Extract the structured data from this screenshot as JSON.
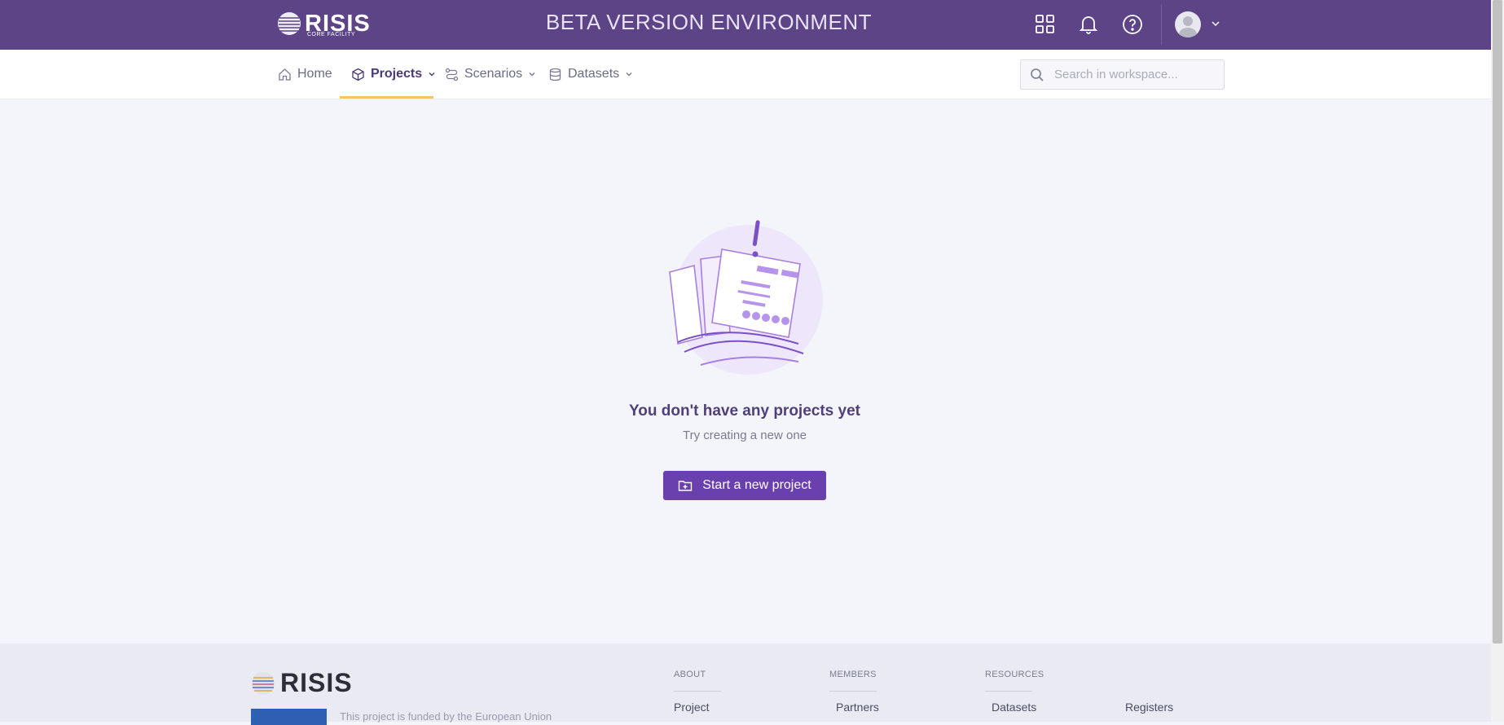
{
  "topbar": {
    "logo_name": "RISIS",
    "logo_sub": "CORE FACILITY",
    "env_title": "BETA VERSION ENVIRONMENT"
  },
  "nav": {
    "items": [
      {
        "label": "Home",
        "icon": "home-icon"
      },
      {
        "label": "Projects",
        "icon": "cube-icon",
        "active": true
      },
      {
        "label": "Scenarios",
        "icon": "flow-icon"
      },
      {
        "label": "Datasets",
        "icon": "database-icon"
      }
    ],
    "search_placeholder": "Search in workspace..."
  },
  "empty_state": {
    "title": "You don't have any projects yet",
    "subtitle": "Try creating a new one",
    "button_label": "Start a new project"
  },
  "footer": {
    "logo_name": "RISIS",
    "funded_text": "This project is funded by the European Union",
    "columns": [
      {
        "heading": "ABOUT",
        "link": "Project"
      },
      {
        "heading": "MEMBERS",
        "link": "Partners"
      },
      {
        "heading": "RESOURCES",
        "link": "Datasets"
      },
      {
        "heading": "",
        "link": "Registers"
      }
    ]
  },
  "colors": {
    "topbar": "#5c4487",
    "accent": "#6a3fae",
    "nav_underline": "#f3c56b"
  }
}
